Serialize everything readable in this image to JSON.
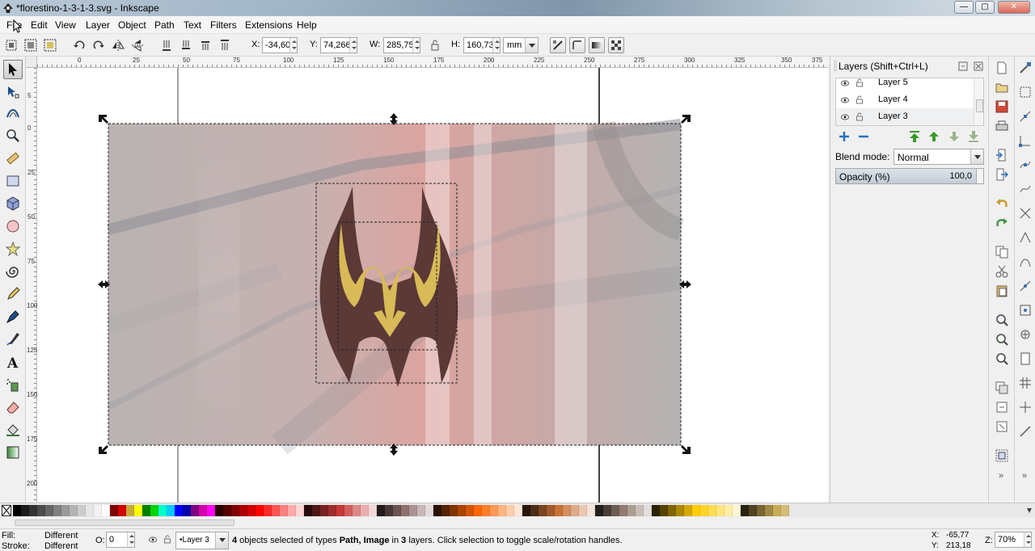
{
  "window": {
    "title": "*florestino-1-3-1-3.svg - Inkscape",
    "minimize_glyph": "—",
    "maximize_glyph": "▢",
    "close_glyph": "✕"
  },
  "menu": [
    "File",
    "Edit",
    "View",
    "Layer",
    "Object",
    "Path",
    "Text",
    "Filters",
    "Extensions",
    "Help"
  ],
  "toolcontrols": {
    "x_label": "X:",
    "x_value": "-34,603",
    "y_label": "Y:",
    "y_value": "74,266",
    "w_label": "W:",
    "w_value": "285,750",
    "h_label": "H:",
    "h_value": "160,734",
    "unit": "mm"
  },
  "ruler": {
    "top_labels": [
      "0",
      "25",
      "50",
      "75",
      "100",
      "125",
      "150",
      "175",
      "200",
      "225",
      "250",
      "275",
      "300",
      "325",
      "350",
      "375"
    ],
    "left_labels": [
      "5",
      "0",
      "25",
      "50",
      "75",
      "100",
      "125",
      "150",
      "175",
      "200"
    ]
  },
  "layers_panel": {
    "title": "Layers (Shift+Ctrl+L)",
    "layers": [
      {
        "name": "Layer 5"
      },
      {
        "name": "Layer 4"
      },
      {
        "name": "Layer 3"
      }
    ],
    "blend_mode_label": "Blend mode:",
    "blend_mode_value": "Normal",
    "opacity_label": "Opacity (%)",
    "opacity_value": "100,0"
  },
  "palette": {
    "colors": [
      "#000000",
      "#1a1a1a",
      "#333333",
      "#4d4d4d",
      "#666666",
      "#808080",
      "#999999",
      "#b3b3b3",
      "#cccccc",
      "#e6e6e6",
      "#f2f2f2",
      "#ffffff",
      "#800000",
      "#d40000",
      "#c8ab37",
      "#ffff00",
      "#008000",
      "#00d400",
      "#00ffcc",
      "#00ccff",
      "#0000ff",
      "#0000aa",
      "#800080",
      "#d400aa",
      "#ff00ff",
      "#2b0000",
      "#550000",
      "#800000",
      "#aa0000",
      "#d40000",
      "#ff0000",
      "#ff2a2a",
      "#ff5555",
      "#ff8080",
      "#ffaaaa",
      "#ffd5d5",
      "#280b0b",
      "#501616",
      "#782121",
      "#a02c2c",
      "#c83737",
      "#d35f5f",
      "#de8787",
      "#e9afaf",
      "#f4d7d7",
      "#241c1c",
      "#483737",
      "#6c5353",
      "#916f6f",
      "#ac9393",
      "#c8b7b7",
      "#e3dbdb",
      "#2b1100",
      "#552200",
      "#803300",
      "#aa4400",
      "#d45500",
      "#ff6600",
      "#ff7f2a",
      "#ff9955",
      "#ffb380",
      "#ffccaa",
      "#ffe6d5",
      "#28170b",
      "#502d16",
      "#784421",
      "#a05a2c",
      "#c87137",
      "#d38d5f",
      "#deaa87",
      "#e9c6af",
      "#f4e3d7",
      "#241f1c",
      "#483e37",
      "#6c5d53",
      "#917c6f",
      "#ac9d93",
      "#c8beb7",
      "#e3dedb",
      "#2b2200",
      "#554400",
      "#806600",
      "#aa8800",
      "#d4aa00",
      "#ffcc00",
      "#ffd42a",
      "#ffdd55",
      "#ffe680",
      "#ffeeaa",
      "#fff6d5",
      "#282211",
      "#504422",
      "#786633",
      "#a08844",
      "#c8aa55",
      "#d4bb77"
    ]
  },
  "status": {
    "fill_label": "Fill:",
    "fill_value": "Different",
    "stroke_label": "Stroke:",
    "stroke_value": "Different",
    "opacity_label": "O:",
    "opacity_value": "0",
    "layer_value": "•Layer 3",
    "message_count": "4",
    "message_mid1": " objects selected of types ",
    "message_types": "Path, Image",
    "message_mid2": " in ",
    "message_layers": "3",
    "message_end": " layers. Click selection to toggle scale/rotation handles.",
    "coord_x_label": "X:",
    "coord_x": "-65,77",
    "coord_y_label": "Y:",
    "coord_y": "213,18",
    "zoom_label": "Z:",
    "zoom_value": "70%"
  }
}
